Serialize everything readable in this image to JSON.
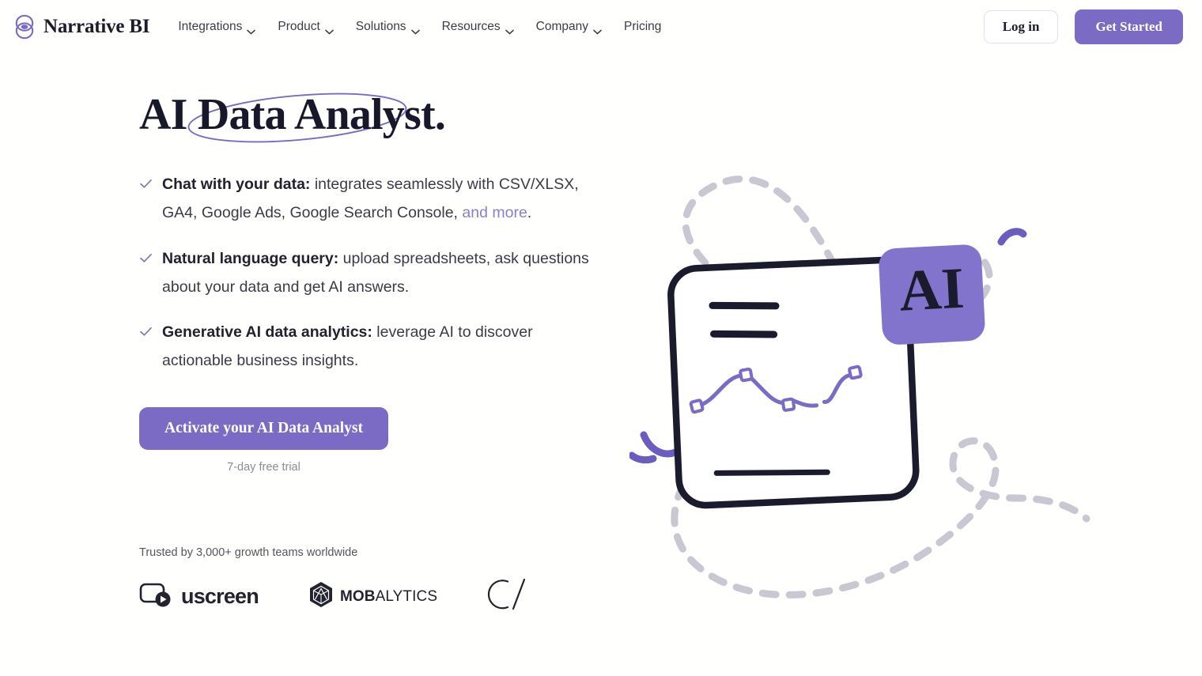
{
  "brand": {
    "name": "Narrative BI",
    "logo_icon": "narrative-bi-eye-logo",
    "accent_color": "#7c6bc4"
  },
  "nav": {
    "items": [
      {
        "label": "Integrations",
        "has_dropdown": true
      },
      {
        "label": "Product",
        "has_dropdown": true
      },
      {
        "label": "Solutions",
        "has_dropdown": true
      },
      {
        "label": "Resources",
        "has_dropdown": true
      },
      {
        "label": "Company",
        "has_dropdown": true
      },
      {
        "label": "Pricing",
        "has_dropdown": false
      }
    ],
    "login_label": "Log in",
    "get_started_label": "Get Started"
  },
  "hero": {
    "headline": "AI Data Analyst.",
    "bullets": [
      {
        "lead": "Chat with your data:",
        "body": " integrates seamlessly with CSV/XLSX, GA4, Google Ads, Google Search Console, ",
        "link": "and more",
        "tail": "."
      },
      {
        "lead": "Natural language query:",
        "body": " upload spreadsheets, ask questions about your data and get AI answers.",
        "link": "",
        "tail": ""
      },
      {
        "lead": "Generative AI data analytics:",
        "body": " leverage AI to discover actionable business insights.",
        "link": "",
        "tail": ""
      }
    ],
    "cta_label": "Activate your AI Data Analyst",
    "cta_note": "7-day free trial"
  },
  "trusted": {
    "label": "Trusted by 3,000+ growth teams worldwide",
    "logos": [
      {
        "name": "uscreen",
        "wordmark": "uscreen",
        "icon": "uscreen-play-icon"
      },
      {
        "name": "mobalytics",
        "wordmark_bold": "MOB",
        "wordmark_light": "ALYTICS",
        "icon": "mobalytics-d20-icon"
      },
      {
        "name": "c-slash",
        "wordmark": "C/",
        "icon": "c-slash-logo"
      }
    ]
  },
  "illustration": {
    "name": "ai-report-card-illustration",
    "badge_label": "AI",
    "badge_color": "#8273cc",
    "card_outline_color": "#1b1b2e",
    "chart_color": "#7c6bc4",
    "dashed_color": "#c9c7d2"
  }
}
